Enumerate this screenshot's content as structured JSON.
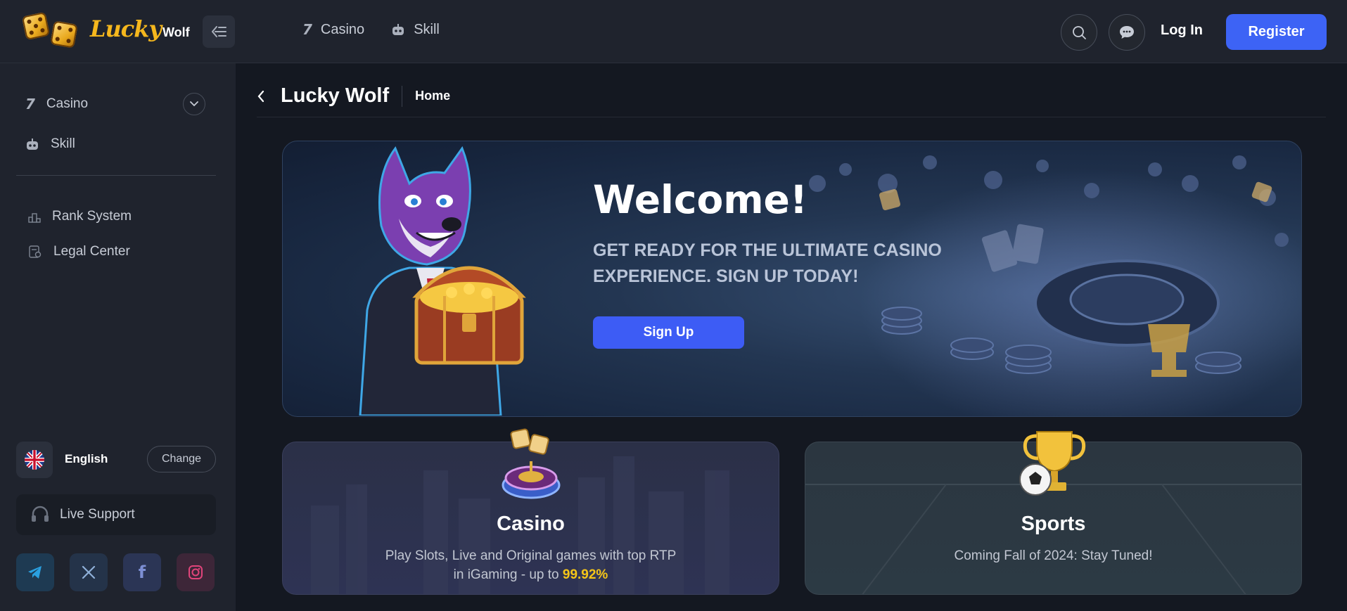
{
  "header": {
    "logo": {
      "lucky": "Lucky",
      "wolf": "Wolf"
    },
    "nav": [
      {
        "label": "Casino",
        "icon": "seven-icon"
      },
      {
        "label": "Skill",
        "icon": "robot-icon"
      }
    ],
    "login_label": "Log In",
    "register_label": "Register"
  },
  "sidebar": {
    "items": [
      {
        "label": "Casino",
        "icon": "seven-icon"
      },
      {
        "label": "Skill",
        "icon": "robot-icon"
      },
      {
        "label": "Rank System",
        "icon": "podium-icon"
      },
      {
        "label": "Legal Center",
        "icon": "document-icon"
      }
    ],
    "language": {
      "name": "English",
      "change_label": "Change"
    },
    "support_label": "Live Support",
    "socials": [
      "telegram-icon",
      "x-icon",
      "facebook-icon",
      "instagram-icon"
    ]
  },
  "breadcrumb": {
    "title": "Lucky Wolf",
    "current": "Home"
  },
  "banner": {
    "title": "Welcome!",
    "subtitle": "GET READY FOR THE ULTIMATE CASINO EXPERIENCE. SIGN UP TODAY!",
    "cta_label": "Sign Up"
  },
  "cards": {
    "casino": {
      "title": "Casino",
      "desc_prefix": "Play Slots, Live and Original games with top RTP in iGaming - up to ",
      "desc_highlight": "99.92%"
    },
    "sports": {
      "title": "Sports",
      "desc": "Coming Fall of 2024: Stay Tuned!"
    }
  },
  "colors": {
    "accent": "#3d63f5",
    "highlight": "#f5c518",
    "logo_gold": "#f5b71d",
    "background": "#141821",
    "panel": "#1f232d"
  }
}
